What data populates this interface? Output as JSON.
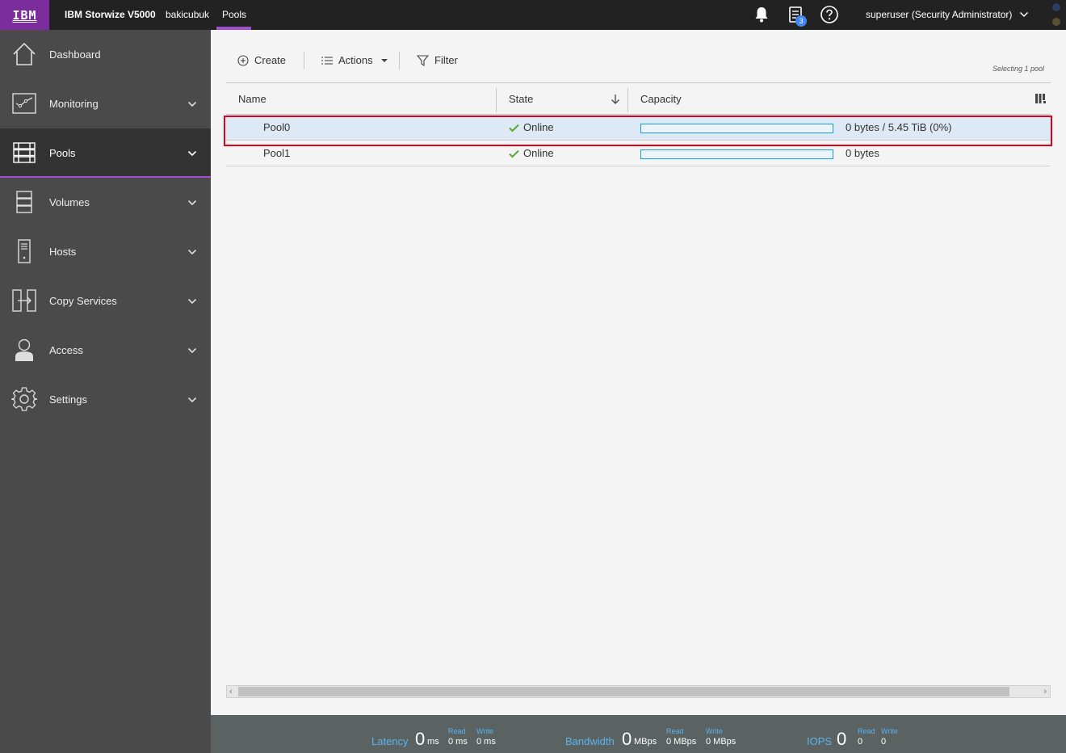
{
  "topbar": {
    "logo": "IBM",
    "product": "IBM Storwize V5000",
    "system": "bakicubuk",
    "page": "Pools",
    "tasks_badge": "3",
    "user": "superuser (Security Administrator)",
    "icons": [
      "bell-icon",
      "tasks-icon",
      "help-icon",
      "chevron-down-icon"
    ],
    "brand_color": "#7b2d9e"
  },
  "sidebar": {
    "items": [
      {
        "label": "Dashboard",
        "icon": "dashboard-icon",
        "active": false
      },
      {
        "label": "Monitoring",
        "icon": "monitoring-icon",
        "active": false
      },
      {
        "label": "Pools",
        "icon": "pools-icon",
        "active": true
      },
      {
        "label": "Volumes",
        "icon": "volumes-icon",
        "active": false
      },
      {
        "label": "Hosts",
        "icon": "hosts-icon",
        "active": false
      },
      {
        "label": "Copy Services",
        "icon": "copy-services-icon",
        "active": false
      },
      {
        "label": "Access",
        "icon": "access-icon",
        "active": false
      },
      {
        "label": "Settings",
        "icon": "settings-icon",
        "active": false
      }
    ]
  },
  "toolbar": {
    "create_label": "Create",
    "actions_label": "Actions",
    "filter_label": "Filter",
    "selecting_text": "Selecting 1 pool"
  },
  "table": {
    "columns": {
      "name": "Name",
      "state": "State",
      "capacity": "Capacity"
    },
    "rows": [
      {
        "name": "Pool0",
        "state": "Online",
        "capacity": "0 bytes / 5.45 TiB (0%)",
        "usage_fraction": 0,
        "selected": true
      },
      {
        "name": "Pool1",
        "state": "Online",
        "capacity": "0 bytes",
        "usage_fraction": 0,
        "selected": false
      }
    ]
  },
  "statusbar": {
    "latency": {
      "label": "Latency",
      "value": "0",
      "unit": "ms",
      "read_label": "Read",
      "read": "0 ms",
      "write_label": "Write",
      "write": "0 ms"
    },
    "bandwidth": {
      "label": "Bandwidth",
      "value": "0",
      "unit": "MBps",
      "read_label": "Read",
      "read": "0 MBps",
      "write_label": "Write",
      "write": "0 MBps"
    },
    "iops": {
      "label": "IOPS",
      "value": "0",
      "read_label": "Read",
      "read": "0",
      "write_label": "Write",
      "write": "0"
    }
  }
}
